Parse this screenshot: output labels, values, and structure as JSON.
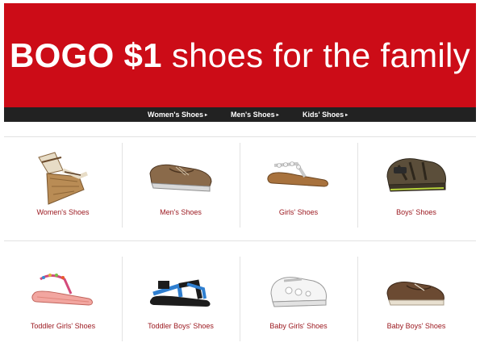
{
  "banner": {
    "headline_bold": "BOGO $1",
    "headline_rest": "shoes for the family",
    "background_color": "#cc0c17"
  },
  "nav": {
    "items": [
      {
        "label": "Women's Shoes"
      },
      {
        "label": "Men's Shoes"
      },
      {
        "label": "Kids' Shoes"
      }
    ],
    "caret_glyph": "▸"
  },
  "grid": {
    "row1": [
      {
        "label": "Women's Shoes",
        "icon": "wedge-sandal-icon"
      },
      {
        "label": "Men's Shoes",
        "icon": "boat-shoe-icon"
      },
      {
        "label": "Girls' Shoes",
        "icon": "jeweled-thong-sandal-icon"
      },
      {
        "label": "Boys' Shoes",
        "icon": "closed-toe-sport-sandal-icon"
      }
    ],
    "row2": [
      {
        "label": "Toddler Girls' Shoes",
        "icon": "beaded-flat-sandal-icon"
      },
      {
        "label": "Toddler Boys' Shoes",
        "icon": "strap-sport-sandal-icon"
      },
      {
        "label": "Baby Girls' Shoes",
        "icon": "white-mary-jane-icon"
      },
      {
        "label": "Baby Boys' Shoes",
        "icon": "baby-loafer-icon"
      }
    ],
    "label_color": "#9c1a21"
  }
}
